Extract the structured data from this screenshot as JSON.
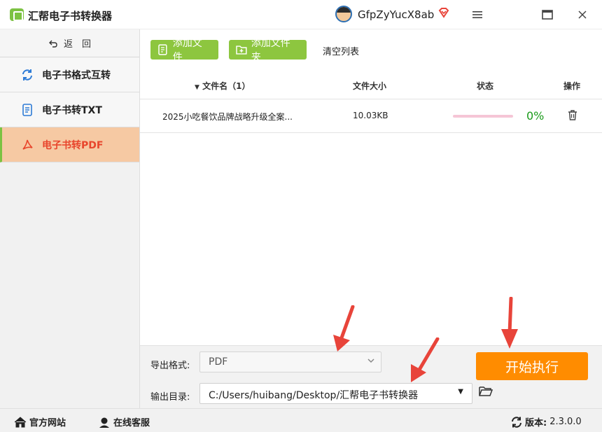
{
  "app": {
    "title": "汇帮电子书转换器",
    "username": "GfpZyYucX8ab",
    "icons": {
      "logo": "book-logo-icon",
      "vip": "diamond-icon",
      "menu": "hamburger-icon",
      "maximize": "maximize-icon",
      "close": "close-icon"
    }
  },
  "sidebar": {
    "back_label": "返　回",
    "items": [
      {
        "label": "电子书格式互转",
        "icon": "refresh-icon"
      },
      {
        "label": "电子书转TXT",
        "icon": "document-icon"
      },
      {
        "label": "电子书转PDF",
        "icon": "pdf-icon",
        "active": true
      }
    ]
  },
  "toolbar": {
    "add_file": "添加文件",
    "add_folder": "添加文件夹",
    "clear_list": "清空列表"
  },
  "table": {
    "columns": {
      "name": "文件名（1）",
      "size": "文件大小",
      "status": "状态",
      "action": "操作"
    },
    "rows": [
      {
        "name": "2025小吃餐饮品牌战略升级全案...",
        "size": "10.03KB",
        "progress": 0.0,
        "percent": "0%"
      }
    ]
  },
  "bottom": {
    "format_label": "导出格式:",
    "format_value": "PDF",
    "outdir_label": "输出目录:",
    "outdir_value": "C:/Users/huibang/Desktop/汇帮电子书转换器",
    "start_label": "开始执行"
  },
  "statusbar": {
    "website": "官方网站",
    "service": "在线客服",
    "version_label": "版本:",
    "version_value": "2.3.0.0"
  },
  "colors": {
    "accent_green": "#8dc63f",
    "start_orange": "#ff8c00",
    "active_bg": "#f6c9a3",
    "active_text": "#e8452c",
    "progress_pct": "#1a9b1a",
    "annotation_arrow": "#e8443a"
  }
}
